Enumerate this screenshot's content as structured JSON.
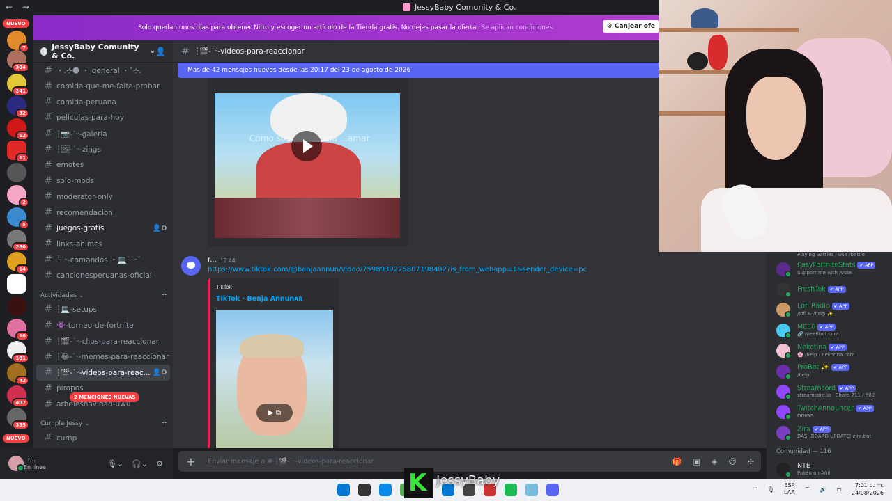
{
  "window": {
    "nav_back": "←",
    "nav_forward": "→",
    "title": "JessyBaby Comunity & Co."
  },
  "promo": {
    "text": "Solo quedan unos días para obtener Nitro y escoger un artículo de la Tienda gratis. No dejes pasar la oferta.",
    "link": "Se aplican condiciones.",
    "redeem_label": "Canjear ofe"
  },
  "rail": {
    "new_top": "NUEVO",
    "new_bottom": "NUEVO",
    "badges": [
      "7",
      "304",
      "241",
      "32",
      "12",
      "11",
      "2",
      "5",
      "280",
      "14",
      "16",
      "181",
      "42",
      "407",
      "335"
    ]
  },
  "sidebar": {
    "guild_name": "JessyBaby Comunity & Co.",
    "channels_top": [
      {
        "label": "・.⊹🌑 ・ general ・˚⊹.",
        "state": "normal"
      },
      {
        "label": "comida-que-me-falta-probar",
        "state": "normal"
      },
      {
        "label": "comida-peruana",
        "state": "normal"
      },
      {
        "label": "peliculas-para-hoy",
        "state": "normal"
      },
      {
        "label": "┆📷-˙ᵕ-galeria",
        "state": "normal"
      },
      {
        "label": "┆🖼-˙ᵕ-zings",
        "state": "normal"
      },
      {
        "label": "emotes",
        "state": "normal"
      },
      {
        "label": "solo-mods",
        "state": "normal"
      },
      {
        "label": "moderator-only",
        "state": "normal"
      },
      {
        "label": "recomendacion",
        "state": "normal"
      },
      {
        "label": "juegos-gratis",
        "state": "bright"
      },
      {
        "label": "links-animes",
        "state": "normal"
      },
      {
        "label": "╰˙ᵕ-comandos ・💻˘˘ᵕ˘",
        "state": "normal"
      },
      {
        "label": "cancionesperuanas-oficial",
        "state": "normal"
      }
    ],
    "category_activities": "Actividades",
    "channels_activities": [
      {
        "label": "┆💻-setups",
        "state": "normal"
      },
      {
        "label": "👾-torneo-de-fortnite",
        "state": "normal"
      },
      {
        "label": "┆🎬-˙ᵕ-clips-para-reaccionar",
        "state": "normal"
      },
      {
        "label": "┆😂-˙ᵕ-memes-para-reaccionar",
        "state": "normal"
      },
      {
        "label": "┆🎬-˙ᵕ-videos-para-reac...",
        "state": "selected"
      },
      {
        "label": "piropos",
        "state": "normal"
      },
      {
        "label": "arbolesnavidad-uwu",
        "state": "normal"
      }
    ],
    "category_birthday": "Cumple Jessy",
    "channels_birthday": [
      {
        "label": "cump",
        "state": "normal"
      }
    ],
    "mentions_pill": "2 MENCIONES NUEVAS"
  },
  "user": {
    "name": "i...",
    "status": "En línea"
  },
  "chat": {
    "channel_name": "┆🎬-˙ᵕ-videos-para-reaccionar",
    "new_messages_bar": "Más de 42 mensajes nuevos desde las 20:17 del 23 de agosto de 2026",
    "video_caption": "Como sus... estupida ...amar",
    "message": {
      "author": "r...",
      "time": "12:44",
      "url": "https://www.tiktok.com/@benjaannun/video/7598939275807198482?is_from_webapp=1&sender_device=pc"
    },
    "embed": {
      "provider": "TikTok",
      "title": "TikTok · Benja Annunᴀʀ"
    },
    "composer_placeholder": "Enviar mensaje a # ┆🎬-˙ᵕ-videos-para-reaccionar"
  },
  "members": {
    "partial_status": "Playing Battles / Use /battle",
    "list": [
      {
        "name": "EasyFortniteStats",
        "app": "✔ APP",
        "status": "Support me with /vote",
        "color": "#5a2a8c"
      },
      {
        "name": "FreshTok",
        "app": "✔ APP",
        "status": "",
        "color": "#333"
      },
      {
        "name": "Lofi Radio",
        "app": "✔ APP",
        "status": "/lofi & /help ✨",
        "color": "#c96"
      },
      {
        "name": "MEE6",
        "app": "✔ APP",
        "status": "🔗 mee6bot.com",
        "color": "#49c8f0"
      },
      {
        "name": "Nekotina",
        "app": "✔ APP",
        "status": "🌸 /help · nekotina.com",
        "color": "#f0c0d0"
      },
      {
        "name": "ProBot ✨",
        "app": "✔ APP",
        "status": "/help",
        "color": "#6a2fa8"
      },
      {
        "name": "Streamcord",
        "app": "✔ APP",
        "status": "streamcord.io · Shard 711 / 800",
        "color": "#9146ff"
      },
      {
        "name": "TwitchAnnouncer",
        "app": "✔ APP",
        "status": "DDIGG",
        "color": "#9146ff"
      },
      {
        "name": "Zira",
        "app": "✔ APP",
        "status": "DASHBOARD UPDATE! zira.bot",
        "color": "#7a3fc0"
      }
    ],
    "community_header": "Comunidad — 116",
    "community_first": {
      "name": "NTE",
      "status": "Pokémon Añil"
    }
  },
  "overlay": {
    "text": "JessyBaby"
  },
  "taskbar": {
    "lang_top": "ESP",
    "lang_bottom": "LAA",
    "time": "7:01 p. m.",
    "date": "24/08/2026",
    "icon_colors": [
      "#0078d4",
      "#333",
      "#0c8ae8",
      "#5a5",
      "#f4a000",
      "#0078d4",
      "#444",
      "#c33",
      "#1db954",
      "#7bd",
      "#5865f2"
    ]
  }
}
